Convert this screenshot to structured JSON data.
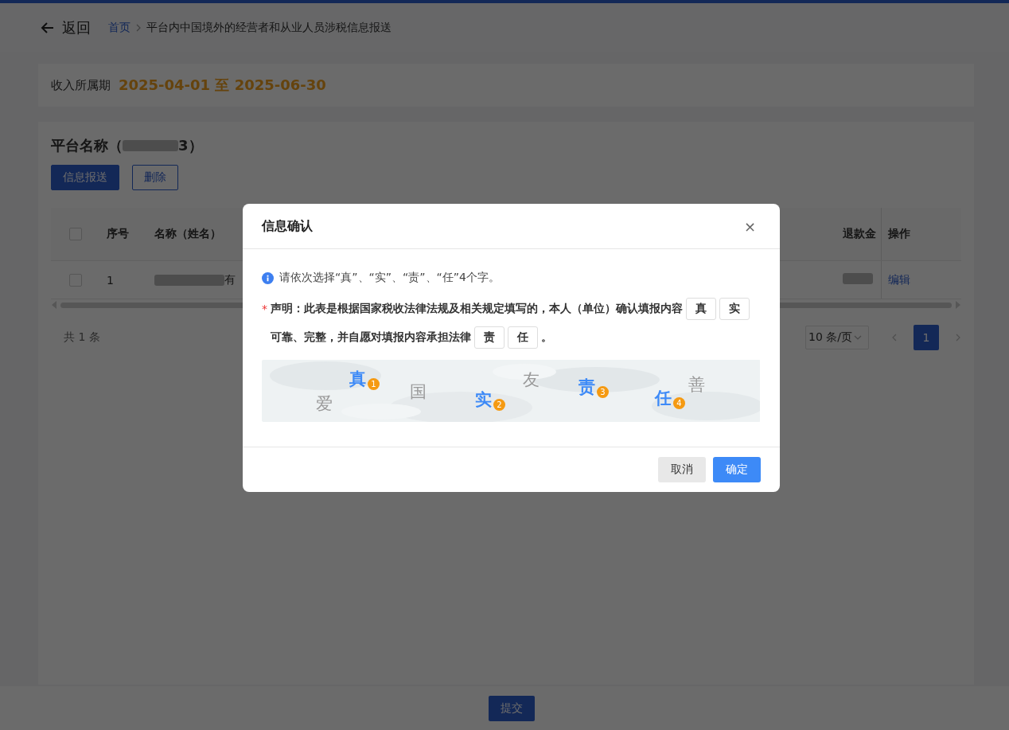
{
  "header": {
    "back_label": "返回",
    "breadcrumb": [
      {
        "label": "首页",
        "kind": "link"
      },
      {
        "label": "平台内中国境外的经营者和从业人员涉税信息报送",
        "kind": "current"
      }
    ]
  },
  "period": {
    "label": "收入所属期",
    "value": "2025-04-01 至 2025-06-30"
  },
  "platform": {
    "title_start": "平台名称（",
    "title_end": "3）",
    "actions": [
      {
        "label": "信息报送",
        "kind": "primary"
      },
      {
        "label": "删除",
        "kind": "outline"
      }
    ]
  },
  "table": {
    "all_checked": false,
    "columns": [
      {
        "label": "序号"
      },
      {
        "label": "名称（姓名）"
      },
      {
        "label": "退款金"
      },
      {
        "label": "操作"
      }
    ],
    "rows": [
      {
        "checked": false,
        "index": "1",
        "name_end": "有",
        "action": "编辑"
      }
    ]
  },
  "pagination": {
    "total": "共 1 条",
    "page_size": "10 条/页",
    "pages": [
      {
        "label": "1",
        "selected": true
      }
    ]
  },
  "footer": {
    "submit": "提交"
  },
  "dialog": {
    "title": "信息确认",
    "close": "×",
    "hint": "请依次选择“真”、“实”、“责”、“任”4个字。",
    "required_mark": "*",
    "statement_1": "声明：此表是根据国家税收法律法规及相关规定填写的，本人（单位）确认填报内容",
    "slots_1": [
      "真",
      "实"
    ],
    "statement_2": "可靠、完整，并自愿对填报内容承担法律",
    "slots_2": [
      "责",
      "任"
    ],
    "statement_end": "。",
    "captcha": [
      {
        "char": "爱",
        "selected": false
      },
      {
        "char": "真",
        "selected": true,
        "order": "1"
      },
      {
        "char": "国",
        "selected": false
      },
      {
        "char": "实",
        "selected": true,
        "order": "2"
      },
      {
        "char": "友",
        "selected": false
      },
      {
        "char": "责",
        "selected": true,
        "order": "3"
      },
      {
        "char": "任",
        "selected": true,
        "order": "4"
      },
      {
        "char": "善",
        "selected": false
      }
    ],
    "buttons": [
      {
        "label": "取消",
        "kind": "secondary"
      },
      {
        "label": "确定",
        "kind": "primary"
      }
    ]
  }
}
